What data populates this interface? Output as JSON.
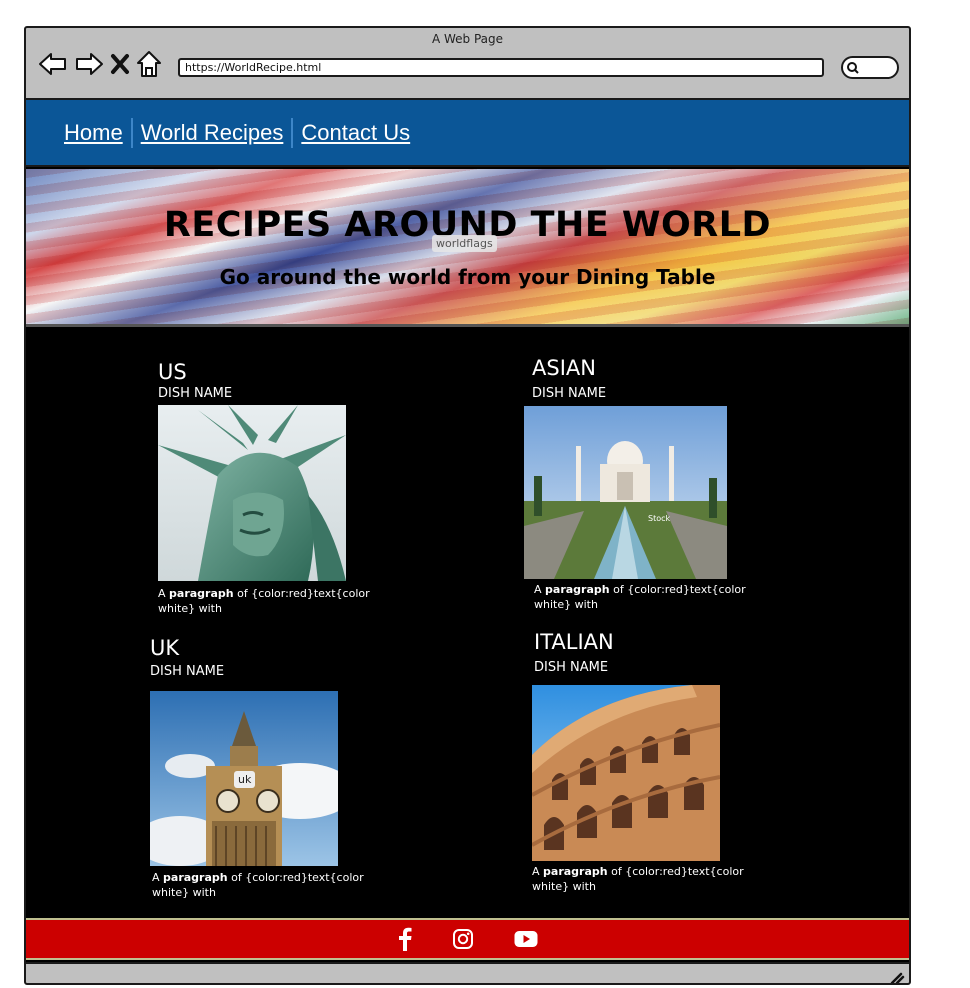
{
  "browser": {
    "title": "A Web Page",
    "url": "https://WorldRecipe.html"
  },
  "nav": {
    "items": [
      {
        "label": "Home"
      },
      {
        "label": "World Recipes"
      },
      {
        "label": "Contact Us"
      }
    ]
  },
  "hero": {
    "title": "RECIPES AROUND THE WORLD",
    "subtitle": "Go around the world from your Dining Table",
    "image_label": "worldflags"
  },
  "cards": [
    {
      "region": "US",
      "dish": "DISH NAME",
      "image_label": "",
      "para_prefix": "A ",
      "para_bold": "paragraph",
      "para_rest": " of {color:red}text{color white} with"
    },
    {
      "region": "ASIAN",
      "dish": "DISH NAME",
      "image_label": "Stock",
      "para_prefix": "A ",
      "para_bold": "paragraph",
      "para_rest": " of {color:red}text{color white} with"
    },
    {
      "region": "UK",
      "dish": "DISH NAME",
      "image_label": "uk",
      "para_prefix": "A ",
      "para_bold": "paragraph",
      "para_rest": " of {color:red}text{color white} with"
    },
    {
      "region": "ITALIAN",
      "dish": "DISH NAME",
      "image_label": "",
      "para_prefix": "A ",
      "para_bold": "paragraph",
      "para_rest": " of {color:red}text{color white} with"
    }
  ],
  "footer": {
    "icons": [
      "facebook-icon",
      "instagram-icon",
      "youtube-icon"
    ]
  },
  "colors": {
    "nav_bg": "#0b5697",
    "footer_bg": "#cc0000",
    "content_bg": "#000000",
    "chrome": "#c0c0c0"
  }
}
